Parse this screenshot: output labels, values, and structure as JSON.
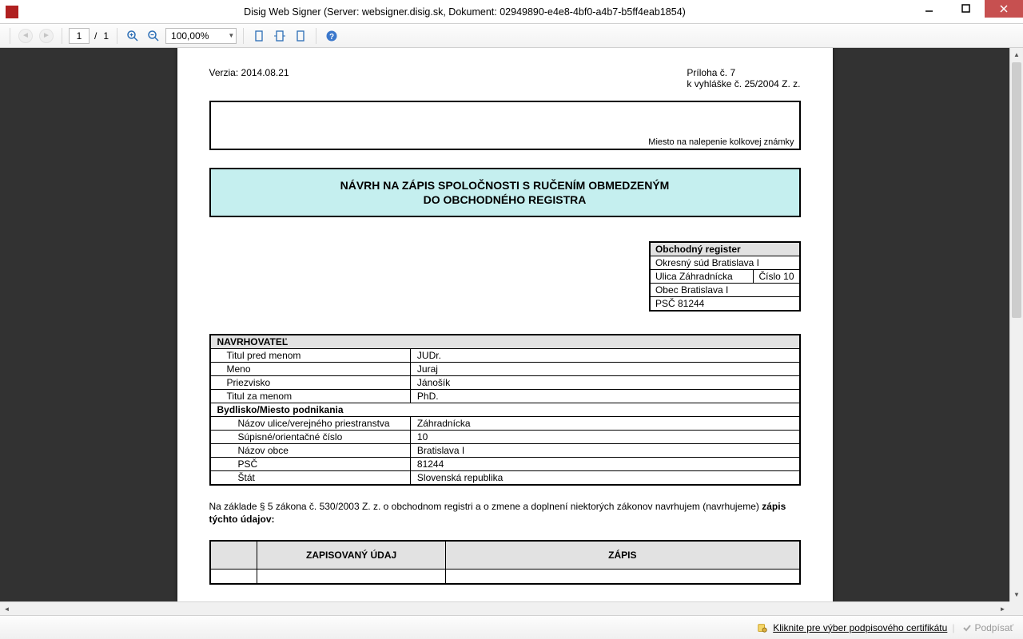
{
  "window": {
    "title": "Disig Web Signer (Server: websigner.disig.sk, Dokument: 02949890-e4e8-4bf0-a4b7-b5ff4eab1854)"
  },
  "toolbar": {
    "page_current": "1",
    "page_sep": "/",
    "page_total": "1",
    "zoom": "100,00%"
  },
  "doc": {
    "version": "Verzia: 2014.08.21",
    "attachment_line1": "Príloha č. 7",
    "attachment_line2": "k vyhláške č. 25/2004 Z. z.",
    "stamp_note": "Miesto na nalepenie kolkovej známky",
    "title_line1": "NÁVRH NA ZÁPIS SPOLOČNOSTI S RUČENÍM OBMEDZENÝM",
    "title_line2": "DO OBCHODNÉHO REGISTRA",
    "register": {
      "header": "Obchodný register",
      "court": "Okresný súd Bratislava I",
      "street": "Ulica Záhradnícka",
      "number_label": "Číslo 10",
      "city": "Obec Bratislava I",
      "zip": "PSČ 81244"
    },
    "navrhovatel": {
      "header": "NAVRHOVATEĽ",
      "rows": [
        {
          "label": "Titul pred menom",
          "value": "JUDr."
        },
        {
          "label": "Meno",
          "value": "Juraj"
        },
        {
          "label": "Priezvisko",
          "value": "Jánošík"
        },
        {
          "label": "Titul za menom",
          "value": "PhD."
        }
      ],
      "address_header": "Bydlisko/Miesto podnikania",
      "address_rows": [
        {
          "label": "Názov ulice/verejného priestranstva",
          "value": "Záhradnícka"
        },
        {
          "label": "Súpisné/orientačné číslo",
          "value": "10"
        },
        {
          "label": "Názov obce",
          "value": "Bratislava I"
        },
        {
          "label": "PSČ",
          "value": "81244"
        },
        {
          "label": "Štát",
          "value": "Slovenská republika"
        }
      ]
    },
    "legal_prefix": "Na základe § 5 zákona č. 530/2003 Z. z. o obchodnom registri a o zmene a doplnení niektorých zákonov navrhujem (navrhujeme) ",
    "legal_bold": "zápis týchto údajov:",
    "zap_table": {
      "col1": "ZAPISOVANÝ ÚDAJ",
      "col2": "ZÁPIS"
    }
  },
  "status": {
    "cert_prompt": "Kliknite pre výber podpisového certifikátu",
    "sign": "Podpísať"
  }
}
